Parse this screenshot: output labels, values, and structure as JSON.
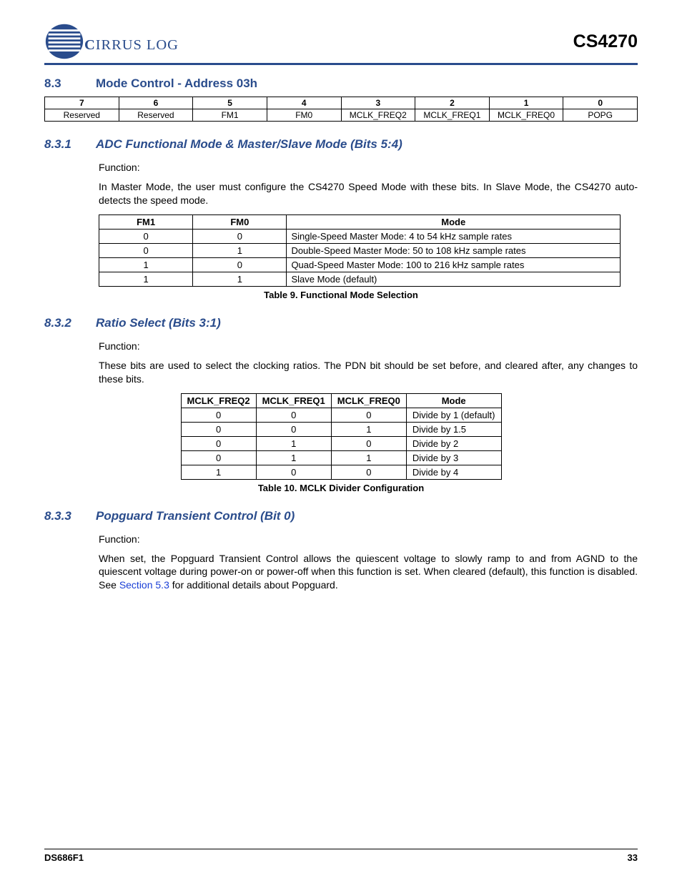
{
  "header": {
    "brand_text": "IRRUS LOGIC",
    "brand_mark": "®",
    "part_number": "CS4270"
  },
  "section": {
    "num": "8.3",
    "title": "Mode Control - Address 03h"
  },
  "bits_table": {
    "headers": [
      "7",
      "6",
      "5",
      "4",
      "3",
      "2",
      "1",
      "0"
    ],
    "cells": [
      "Reserved",
      "Reserved",
      "FM1",
      "FM0",
      "MCLK_FREQ2",
      "MCLK_FREQ1",
      "MCLK_FREQ0",
      "POPG"
    ]
  },
  "s831": {
    "num": "8.3.1",
    "title": "ADC Functional Mode & Master/Slave Mode (Bits 5:4)",
    "fn": "Function:",
    "body": "In Master Mode, the user must configure the CS4270 Speed Mode with these bits. In Slave Mode, the CS4270 auto-detects the speed mode.",
    "table": {
      "headers": [
        "FM1",
        "FM0",
        "Mode"
      ],
      "rows": [
        [
          "0",
          "0",
          "Single-Speed Master Mode: 4 to 54 kHz sample rates"
        ],
        [
          "0",
          "1",
          "Double-Speed Master Mode: 50 to 108 kHz sample rates"
        ],
        [
          "1",
          "0",
          "Quad-Speed Master Mode: 100 to 216 kHz sample rates"
        ],
        [
          "1",
          "1",
          "Slave Mode (default)"
        ]
      ],
      "caption": "Table 9. Functional Mode Selection"
    }
  },
  "s832": {
    "num": "8.3.2",
    "title": "Ratio Select (Bits 3:1)",
    "fn": "Function:",
    "body": "These bits are used to select the clocking ratios. The PDN bit should be set before, and cleared after, any changes to these bits.",
    "table": {
      "headers": [
        "MCLK_FREQ2",
        "MCLK_FREQ1",
        "MCLK_FREQ0",
        "Mode"
      ],
      "rows": [
        [
          "0",
          "0",
          "0",
          "Divide by 1 (default)"
        ],
        [
          "0",
          "0",
          "1",
          "Divide by 1.5"
        ],
        [
          "0",
          "1",
          "0",
          "Divide by 2"
        ],
        [
          "0",
          "1",
          "1",
          "Divide by 3"
        ],
        [
          "1",
          "0",
          "0",
          "Divide by 4"
        ]
      ],
      "caption": "Table 10. MCLK Divider Configuration"
    }
  },
  "s833": {
    "num": "8.3.3",
    "title": "Popguard Transient Control (Bit 0)",
    "fn": "Function:",
    "body_pre": "When set, the Popguard Transient Control allows the quiescent voltage to slowly ramp to and from AGND to the quiescent voltage during power-on or power-off when this function is set. When cleared (default), this function is disabled. See ",
    "link": "Section 5.3",
    "body_post": " for additional details about Popguard."
  },
  "footer": {
    "doc": "DS686F1",
    "page": "33"
  }
}
